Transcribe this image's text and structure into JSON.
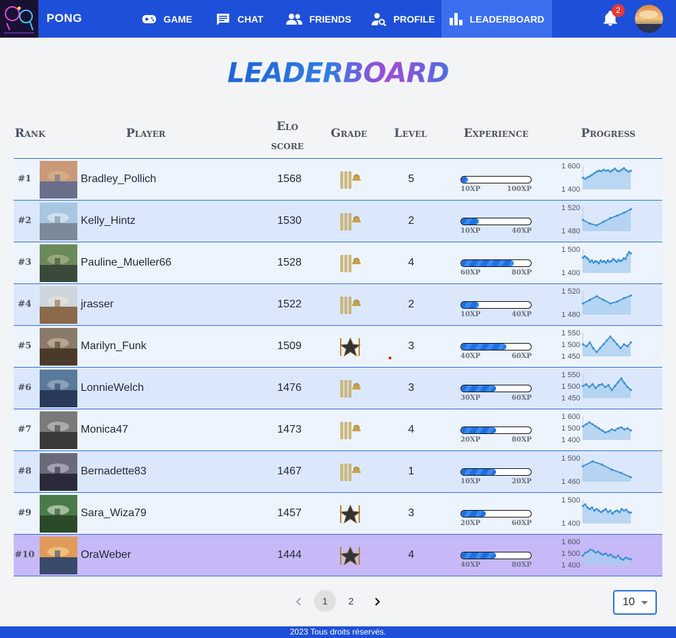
{
  "nav": {
    "brand": "PONG",
    "items": [
      {
        "label": "GAME",
        "icon": "gamepad-icon"
      },
      {
        "label": "CHAT",
        "icon": "chat-icon"
      },
      {
        "label": "FRIENDS",
        "icon": "friends-icon"
      },
      {
        "label": "PROFILE",
        "icon": "profile-search-icon"
      },
      {
        "label": "LEADERBOARD",
        "icon": "leaderboard-icon",
        "active": true
      }
    ],
    "notification_count": "2"
  },
  "page": {
    "title": "LEADERBOARD"
  },
  "table": {
    "headers": {
      "rank": "Rank",
      "player": "Player",
      "elo_line1": "Elo",
      "elo_line2": "score",
      "grade": "Grade",
      "level": "Level",
      "experience": "Experience",
      "progress": "Progress"
    },
    "rows": [
      {
        "rank": "#1",
        "name": "Bradley_Pollich",
        "elo": "1568",
        "grade": "ribbon",
        "level": "5",
        "xp_min": "10XP",
        "xp_max": "100XP",
        "xp_fill": 0.1,
        "y_ticks": [
          "1 600",
          "1 400"
        ],
        "ylim": [
          1390,
          1620
        ],
        "series": [
          1500,
          1490,
          1505,
          1515,
          1530,
          1545,
          1560,
          1570,
          1565,
          1580,
          1570,
          1575,
          1560,
          1575,
          1590,
          1570,
          1565,
          1580,
          1595,
          1575,
          1560,
          1570
        ]
      },
      {
        "rank": "#2",
        "name": "Kelly_Hintz",
        "elo": "1530",
        "grade": "ribbon",
        "level": "2",
        "xp_min": "10XP",
        "xp_max": "40XP",
        "xp_fill": 0.25,
        "y_ticks": [
          "1 520",
          "1 480"
        ],
        "ylim": [
          1470,
          1535
        ],
        "series": [
          1500,
          1490,
          1485,
          1495,
          1505,
          1512,
          1520,
          1530
        ]
      },
      {
        "rank": "#3",
        "name": "Pauline_Mueller66",
        "elo": "1528",
        "grade": "ribbon",
        "level": "4",
        "xp_min": "60XP",
        "xp_max": "80XP",
        "xp_fill": 0.75,
        "y_ticks": [
          "1 500",
          "1 400"
        ],
        "ylim": [
          1395,
          1560
        ],
        "series": [
          1500,
          1510,
          1500,
          1490,
          1470,
          1480,
          1465,
          1475,
          1470,
          1460,
          1480,
          1470,
          1475,
          1465,
          1480,
          1470,
          1475,
          1490,
          1480,
          1470,
          1485,
          1475,
          1480,
          1495,
          1490,
          1520,
          1540,
          1530
        ]
      },
      {
        "rank": "#4",
        "name": "jrasser",
        "elo": "1522",
        "grade": "ribbon",
        "level": "2",
        "xp_min": "10XP",
        "xp_max": "40XP",
        "xp_fill": 0.25,
        "y_ticks": [
          "1 520",
          "1 480"
        ],
        "ylim": [
          1470,
          1535
        ],
        "series": [
          1500,
          1510,
          1520,
          1510,
          1500,
          1505,
          1515,
          1522
        ]
      },
      {
        "rank": "#5",
        "name": "Marilyn_Funk",
        "elo": "1509",
        "grade": "star",
        "level": "3",
        "xp_min": "40XP",
        "xp_max": "60XP",
        "xp_fill": 0.65,
        "y_ticks": [
          "1 550",
          "1 500",
          "1 450"
        ],
        "ylim": [
          1440,
          1560
        ],
        "series": [
          1500,
          1490,
          1510,
          1480,
          1460,
          1480,
          1500,
          1520,
          1540,
          1520,
          1500,
          1480,
          1500,
          1490,
          1510
        ]
      },
      {
        "rank": "#6",
        "name": "LonnieWelch",
        "elo": "1476",
        "grade": "ribbon",
        "level": "3",
        "xp_min": "30XP",
        "xp_max": "60XP",
        "xp_fill": 0.5,
        "y_ticks": [
          "1 550",
          "1 500",
          "1 450"
        ],
        "ylim": [
          1440,
          1560
        ],
        "series": [
          1500,
          1510,
          1495,
          1510,
          1490,
          1505,
          1510,
          1495,
          1505,
          1480,
          1500,
          1520,
          1540,
          1515,
          1495,
          1480
        ]
      },
      {
        "rank": "#7",
        "name": "Monica47",
        "elo": "1473",
        "grade": "ribbon",
        "level": "4",
        "xp_min": "20XP",
        "xp_max": "80XP",
        "xp_fill": 0.5,
        "y_ticks": [
          "1 600",
          "1 500",
          "1 400"
        ],
        "ylim": [
          1390,
          1620
        ],
        "series": [
          1520,
          1540,
          1560,
          1540,
          1520,
          1500,
          1480,
          1460,
          1470,
          1490,
          1480,
          1500,
          1510,
          1490,
          1500,
          1480
        ]
      },
      {
        "rank": "#8",
        "name": "Bernadette83",
        "elo": "1467",
        "grade": "ribbon",
        "level": "1",
        "xp_min": "10XP",
        "xp_max": "20XP",
        "xp_fill": 0.5,
        "y_ticks": [
          "1 500",
          "1 460"
        ],
        "ylim": [
          1455,
          1525
        ],
        "series": [
          1500,
          1515,
          1505,
          1490,
          1480,
          1467
        ]
      },
      {
        "rank": "#9",
        "name": "Sara_Wiza79",
        "elo": "1457",
        "grade": "star",
        "level": "3",
        "xp_min": "20XP",
        "xp_max": "60XP",
        "xp_fill": 0.35,
        "y_ticks": [
          "1 500",
          "1 400"
        ],
        "ylim": [
          1390,
          1540
        ],
        "series": [
          1500,
          1510,
          1490,
          1480,
          1490,
          1470,
          1480,
          1470,
          1460,
          1470,
          1480,
          1460,
          1470,
          1450,
          1465,
          1470,
          1460,
          1480,
          1470,
          1475,
          1460,
          1457
        ]
      },
      {
        "rank": "#10",
        "name": "OraWeber",
        "elo": "1444",
        "grade": "star",
        "level": "4",
        "xp_min": "40XP",
        "xp_max": "80XP",
        "xp_fill": 0.5,
        "y_ticks": [
          "1 600",
          "1 500",
          "1 400"
        ],
        "ylim": [
          1390,
          1620
        ],
        "series": [
          1480,
          1510,
          1520,
          1540,
          1530,
          1510,
          1520,
          1500,
          1490,
          1500,
          1480,
          1490,
          1470,
          1460,
          1480,
          1450,
          1440,
          1460,
          1450,
          1444
        ]
      }
    ]
  },
  "pagination": {
    "pages": [
      "1",
      "2"
    ],
    "current": "1",
    "per_page": "10"
  },
  "footer": {
    "text": "2023 Tous droits réservés."
  },
  "colors": {
    "nav": "#1e4fd8",
    "nav_active": "#3a6ff0",
    "row_odd": "#eef4fd",
    "row_even": "#dbe8fc",
    "row_self": "#c7b8f8",
    "chart_line": "#3a8fd6",
    "chart_fill": "#a7cdef"
  }
}
